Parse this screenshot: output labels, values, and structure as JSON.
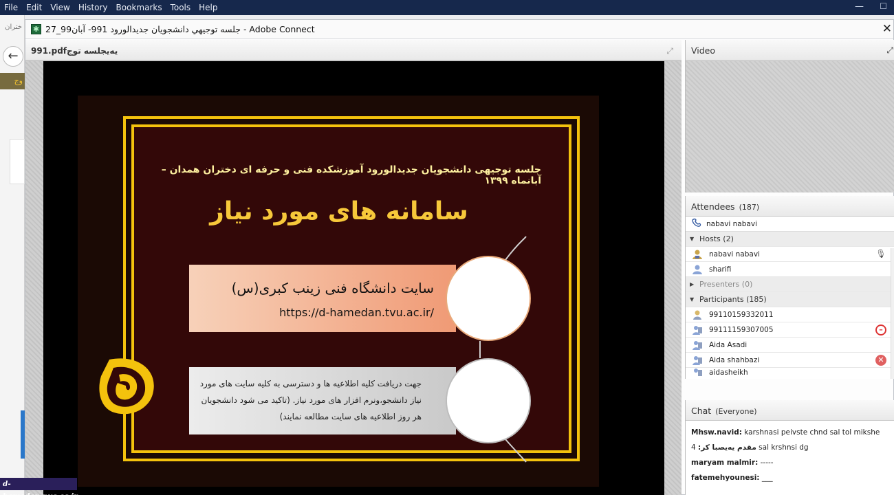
{
  "browser_menu": [
    "File",
    "Edit",
    "View",
    "History",
    "Bookmarks",
    "Tools",
    "Help"
  ],
  "background_page": {
    "tab_fragment": "ختران",
    "gold_fragment": "وج",
    "watermark": "d-hamedan.nus.ac.ir"
  },
  "window": {
    "title": "جلسه توجيهي دانشجويان جديدالورود 991- آبان99_27 - Adobe Connect",
    "close": "✕"
  },
  "share_pod": {
    "title": "991.pdfیه‌یجلسه توج",
    "slide": {
      "subtitle": "جلسه توجیهی دانشجویان جدیدالورود آموزشکده فنی و حرفه ای دختران همدان – آبانماه ۱۳۹۹",
      "title": "سامانه های مورد نیاز",
      "box1_line1": "سایت دانشگاه فنی زینب کبری(س)",
      "box1_line2": "https://d-hamedan.tvu.ac.ir/",
      "box2_text": "جهت دریافت کلیه اطلاعیه ها و دسترسی به کلیه سایت های مورد نیاز دانشجو،ونرم افزار های مورد نیاز. (تاکید می شود دانشجویان هر روز اطلاعیه های سایت مطالعه نمایند)"
    }
  },
  "video_pod": {
    "title": "Video"
  },
  "attendees_pod": {
    "title": "Attendees",
    "count": "(187)",
    "me": "nabavi nabavi",
    "groups": {
      "hosts": "Hosts (2)",
      "presenters": "Presenters (0)",
      "participants": "Participants (185)"
    },
    "hosts": [
      "nabavi nabavi",
      "sharifi"
    ],
    "participants": [
      "99110159332011",
      "99111159307005",
      "Aida Asadi",
      "Aida shahbazi",
      "aidasheikh"
    ]
  },
  "chat_pod": {
    "title": "Chat",
    "scope": "(Everyone)",
    "messages": [
      {
        "sender": "Mhsw.navid:",
        "text": " karshnasi peivste chnd sal tol mikshe"
      },
      {
        "sender": "مقدم یه‌یصبا کر:",
        "text": " 4 sal krshnsi dg"
      },
      {
        "sender": "maryam malmir:",
        "text": " -----"
      },
      {
        "sender": "fatemehyounesi:",
        "text": " ___"
      }
    ]
  },
  "colors": {
    "menubar": "#16284c",
    "gold": "#f4c20d",
    "slide_bg": "#330808",
    "box1": "#f09a75"
  }
}
